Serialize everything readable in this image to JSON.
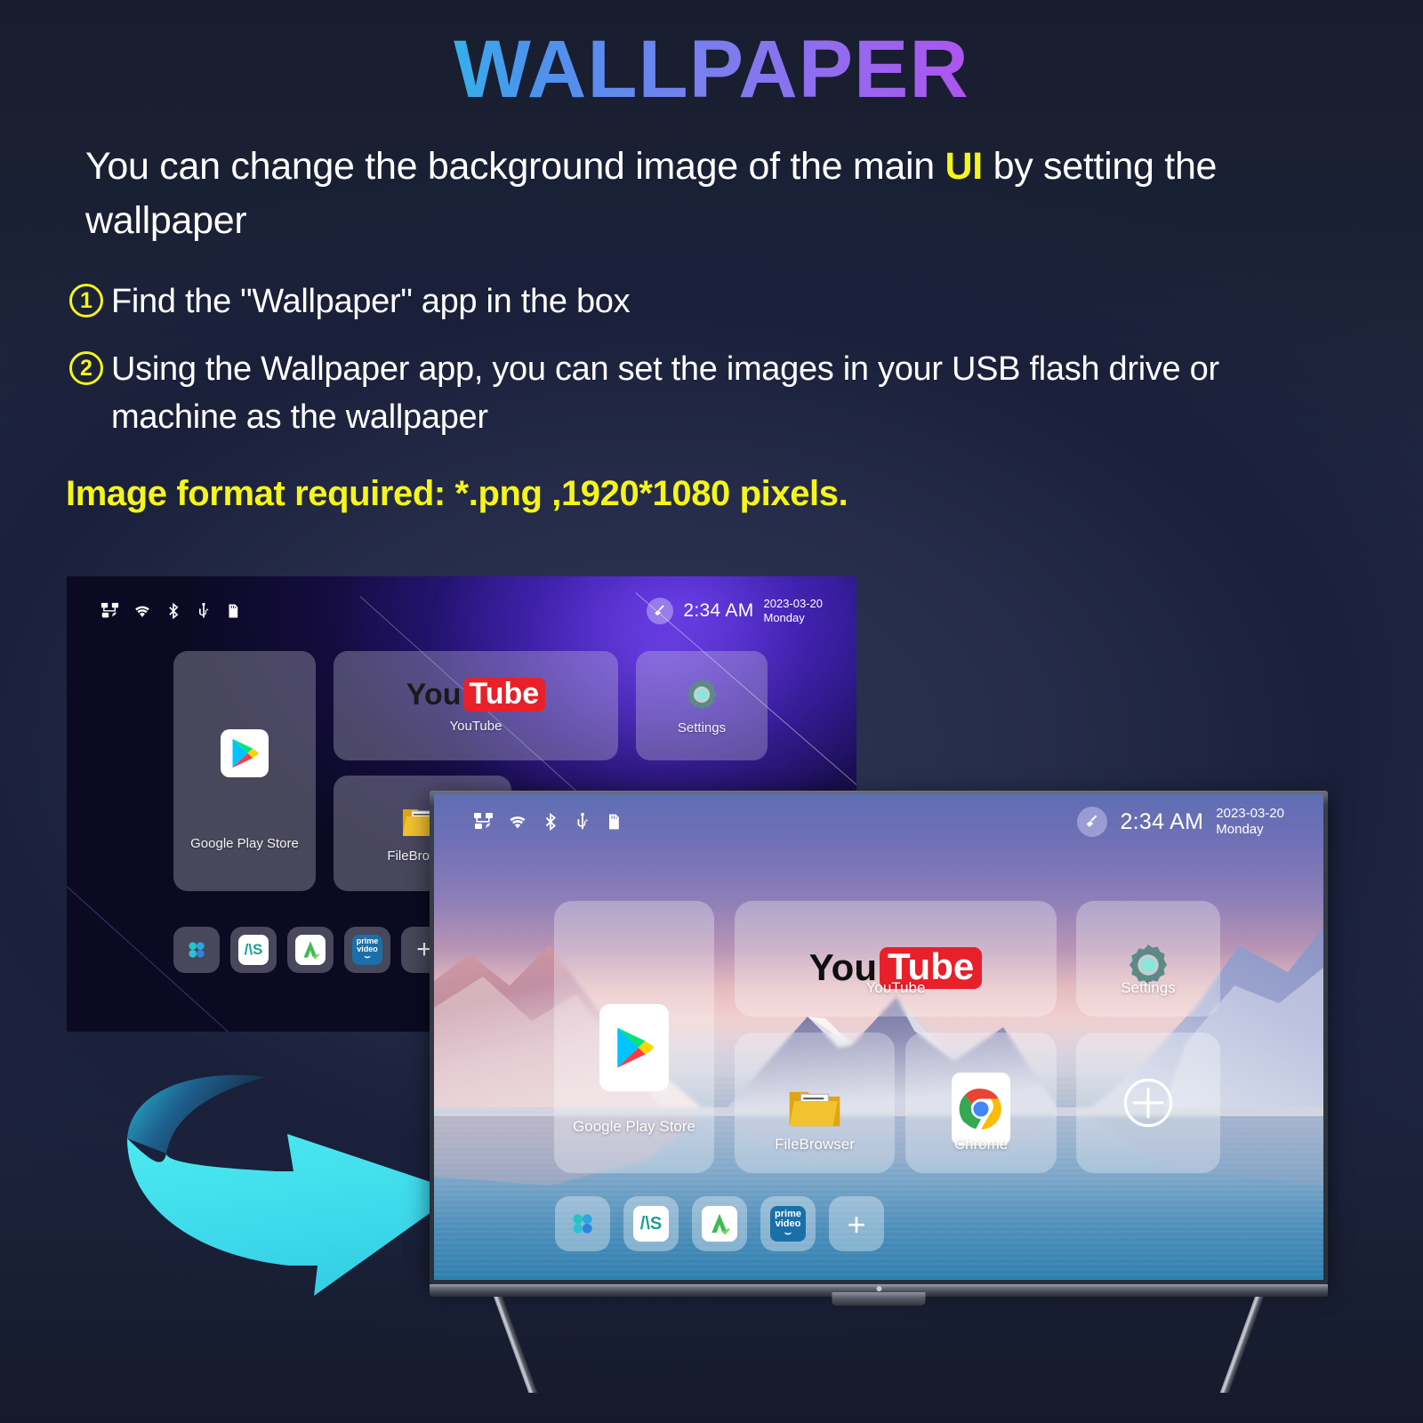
{
  "header": {
    "title": "WALLPAPER",
    "intro_before": "You can change the background image of the main ",
    "intro_highlight": "UI",
    "intro_after": " by setting the wallpaper"
  },
  "steps": [
    {
      "num": "1",
      "text": "Find the \"Wallpaper\" app in the box"
    },
    {
      "num": "2",
      "text": "Using the Wallpaper app, you can set the images in your USB flash drive or machine as the wallpaper"
    }
  ],
  "format_note": "Image format required: *.png ,1920*1080 pixels.",
  "colors": {
    "accent_yellow": "#f5f51a",
    "title_gradient_start": "#17e0e0",
    "title_gradient_end": "#f50ff0",
    "arrow_cyan": "#45e2ec",
    "page_background": "#1b2135"
  },
  "tv_back": {
    "name": "default-dark-wallpaper-screen",
    "statusbar": {
      "icons": [
        "ethernet-icon",
        "wifi-icon",
        "bluetooth-icon",
        "usb-icon",
        "sdcard-icon"
      ],
      "cleaner_icon": "broom-icon",
      "clock": "2:34 AM",
      "date": "2023-03-20",
      "weekday": "Monday"
    },
    "tiles": [
      {
        "label": "Google Play Store",
        "icon": "google-play-icon"
      },
      {
        "label": "YouTube",
        "icon": "youtube-logo"
      },
      {
        "label": "Settings",
        "icon": "settings-gear-icon"
      },
      {
        "label": "FileBrowser",
        "icon": "file-folder-icon"
      }
    ],
    "dock": [
      {
        "icon": "all-apps-grid-icon",
        "label": "All Apps"
      },
      {
        "icon": "as-app-icon",
        "label": "AS"
      },
      {
        "icon": "apkpure-icon",
        "label": "A"
      },
      {
        "icon": "prime-video-icon",
        "label": "prime video"
      },
      {
        "icon": "add-icon",
        "label": "+"
      }
    ]
  },
  "tv_front": {
    "name": "custom-wallpaper-screen",
    "statusbar": {
      "icons": [
        "ethernet-icon",
        "wifi-icon",
        "bluetooth-icon",
        "usb-icon",
        "sdcard-icon"
      ],
      "cleaner_icon": "broom-icon",
      "clock": "2:34 AM",
      "date": "2023-03-20",
      "weekday": "Monday"
    },
    "tiles": [
      {
        "label": "Google Play Store",
        "icon": "google-play-icon"
      },
      {
        "label": "YouTube",
        "icon": "youtube-logo"
      },
      {
        "label": "Settings",
        "icon": "settings-gear-icon"
      },
      {
        "label": "FileBrowser",
        "icon": "file-folder-icon"
      },
      {
        "label": "Chrome",
        "icon": "chrome-icon"
      },
      {
        "label": "",
        "icon": "add-circle-icon"
      }
    ],
    "dock": [
      {
        "icon": "all-apps-grid-icon",
        "label": "All Apps"
      },
      {
        "icon": "as-app-icon",
        "label": "AS"
      },
      {
        "icon": "apkpure-icon",
        "label": "A"
      },
      {
        "icon": "prime-video-icon",
        "label": "prime video"
      },
      {
        "icon": "add-icon",
        "label": "+"
      }
    ]
  },
  "arrow": {
    "name": "curved-arrow-pointing-to-tv",
    "direction": "right"
  }
}
